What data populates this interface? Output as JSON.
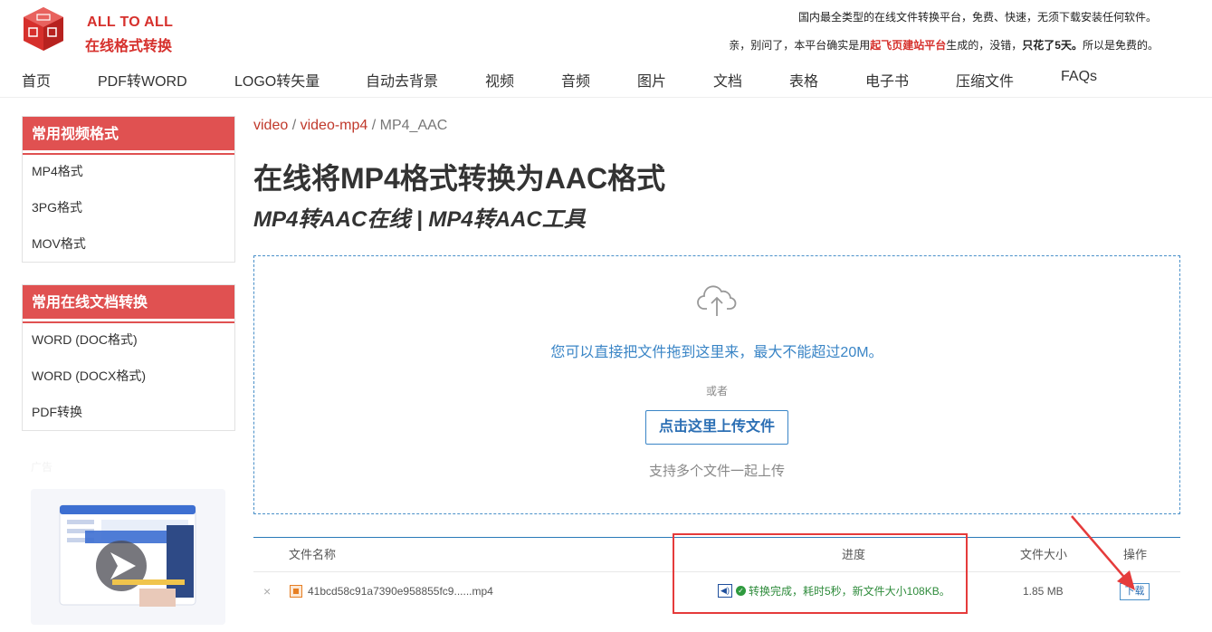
{
  "header": {
    "logo_en": "ALL TO ALL",
    "logo_cn": "在线格式转换",
    "tagline1": "国内最全类型的在线文件转换平台，免费、快速，无须下载安装任何软件。",
    "tagline2_prefix": "亲，别问了，本平台确实是用",
    "tagline2_brand": "起飞页建站平台",
    "tagline2_mid": "生成的，没错，",
    "tagline2_days": "只花了5天。",
    "tagline2_suffix": "所以是免费的。"
  },
  "nav": [
    "首页",
    "PDF转WORD",
    "LOGO转矢量",
    "自动去背景",
    "视频",
    "音频",
    "图片",
    "文档",
    "表格",
    "电子书",
    "压缩文件",
    "FAQs"
  ],
  "sidebar": {
    "video_title": "常用视频格式",
    "video_items": [
      "MP4格式",
      "3PG格式",
      "MOV格式"
    ],
    "doc_title": "常用在线文档转换",
    "doc_items": [
      "WORD (DOC格式)",
      "WORD (DOCX格式)",
      "PDF转换"
    ],
    "ad_label": "广告"
  },
  "breadcrumb": {
    "item1": "video",
    "sep": " / ",
    "item2": "video-mp4",
    "item3": "MP4_AAC"
  },
  "main": {
    "title": "在线将MP4格式转换为AAC格式",
    "subtitle": "MP4转AAC在线 | MP4转AAC工具",
    "drop_text": "您可以直接把文件拖到这里来，最大不能超过20M。",
    "or_text": "或者",
    "upload_button": "点击这里上传文件",
    "multi_text": "支持多个文件一起上传"
  },
  "table": {
    "headers": {
      "name": "文件名称",
      "progress": "进度",
      "size": "文件大小",
      "action": "操作"
    },
    "row": {
      "remove": "×",
      "file_name": "41bcd58c91a7390e958855fc9......mp4",
      "progress": "转换完成，耗时5秒，新文件大小108KB。",
      "size": "1.85 MB",
      "download": "下载"
    }
  },
  "colors": {
    "brand_red": "#d6302c",
    "sidebar_red": "#e05151",
    "link_blue": "#3a85c6",
    "success_green": "#2e8b3b",
    "annotation_red": "#e53b3b"
  }
}
